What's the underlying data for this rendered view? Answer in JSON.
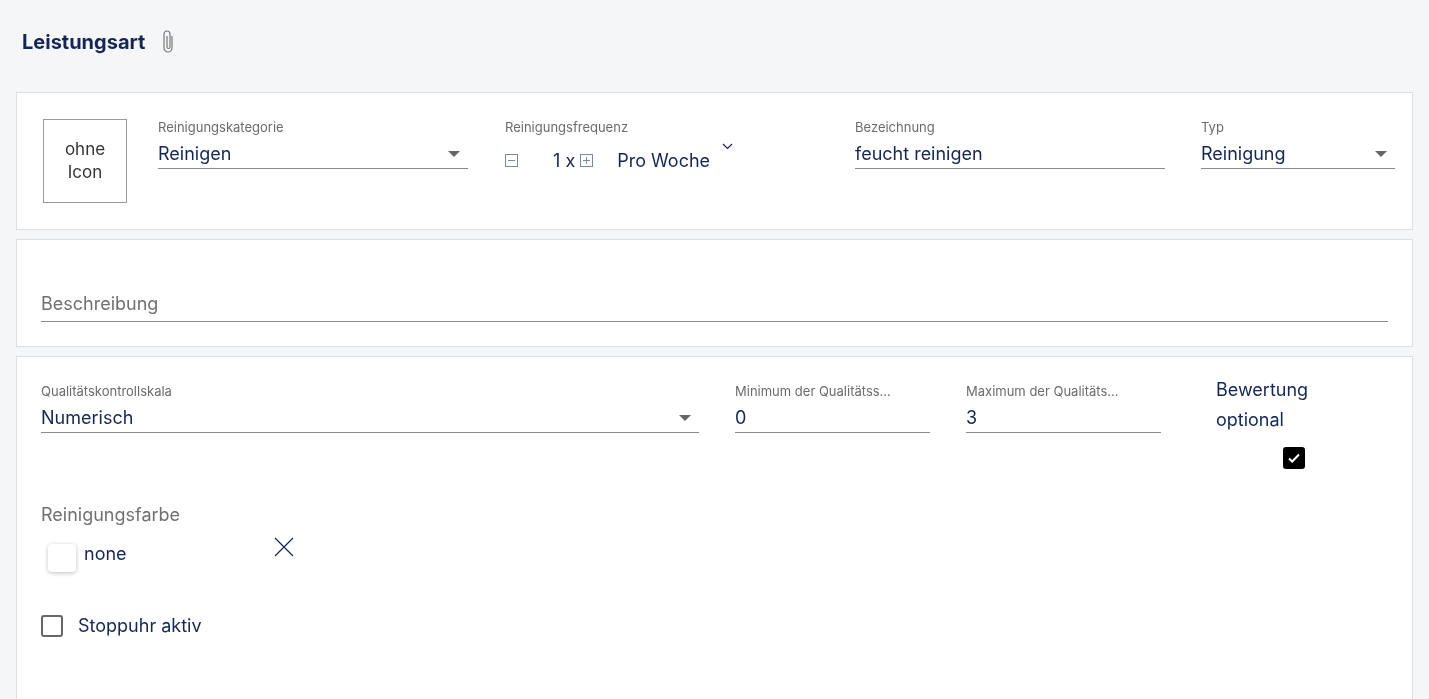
{
  "header": {
    "title": "Leistungsart"
  },
  "general": {
    "icon_box": "ohne Icon",
    "category": {
      "label": "Reinigungskategorie",
      "value": "Reinigen",
      "kind": "select"
    },
    "frequency": {
      "label": "Reinigungsfrequenz",
      "count": "1 x",
      "period": "Pro Woche"
    },
    "name": {
      "label": "Bezeichnung",
      "value": "feucht reinigen"
    },
    "type": {
      "label": "Typ",
      "value": "Reinigung",
      "kind": "select"
    }
  },
  "description": {
    "placeholder": "Beschreibung"
  },
  "quality": {
    "scale": {
      "label": "Qualitätskontrollskala",
      "value": "Numerisch",
      "kind": "select"
    },
    "minimum": {
      "label": "Minimum der Qualitätss...",
      "value": "0"
    },
    "maximum": {
      "label": "Maximum der Qualitäts...",
      "value": "3"
    },
    "rating_optional": {
      "label": "Bewertung optional",
      "checked": true
    },
    "color": {
      "label": "Reinigungsfarbe",
      "value": "none"
    },
    "stopwatch": {
      "label": "Stoppuhr aktiv",
      "checked": false
    }
  }
}
